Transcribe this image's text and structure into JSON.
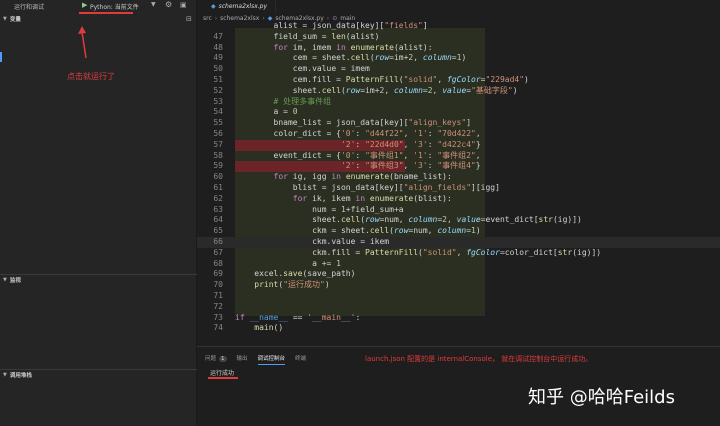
{
  "debug": {
    "toolbar_title": "运行和调试",
    "config_name": "Python: 当前文件",
    "sections": [
      "变量",
      "监视",
      "调用堆栈"
    ]
  },
  "annotation_left": "点击就运行了",
  "tab": {
    "file_name": "schema2xlsx.py"
  },
  "breadcrumb": [
    "src",
    "schema2xlsx",
    "schema2xlsx.py",
    "main"
  ],
  "code_lines": [
    {
      "n": "",
      "html": "        alist = json_data[key][\"fields\"]"
    },
    {
      "n": "47",
      "html": "        field_sum = len(alist)"
    },
    {
      "n": "48",
      "html": "        for im, imem in enumerate(alist):"
    },
    {
      "n": "49",
      "html": "            cem = sheet.cell(row=im+2, column=1)"
    },
    {
      "n": "50",
      "html": "            cem.value = imem"
    },
    {
      "n": "51",
      "html": "            cem.fill = PatternFill(\"solid\", fgColor=\"229ad4\")"
    },
    {
      "n": "52",
      "html": "            sheet.cell(row=im+2, column=2, value=\"基础字段\")"
    },
    {
      "n": "53",
      "html": "        # 处理多事件组"
    },
    {
      "n": "54",
      "html": "        a = 0"
    },
    {
      "n": "55",
      "html": "        bname_list = json_data[key][\"align_keys\"]"
    },
    {
      "n": "56",
      "html": "        color_dict = {'0': \"d44f22\", '1': \"70d422\","
    },
    {
      "n": "57",
      "html": "                      '2': \"22d4d0\", '3': \"d422c4\"}"
    },
    {
      "n": "58",
      "html": "        event_dict = {'0': \"事件组1\", '1': \"事件组2\","
    },
    {
      "n": "59",
      "html": "                      '2': \"事件组3\", '3': \"事件组4\"}"
    },
    {
      "n": "60",
      "html": "        for ig, igg in enumerate(bname_list):"
    },
    {
      "n": "61",
      "html": "            blist = json_data[key][\"align_fields\"][igg]"
    },
    {
      "n": "62",
      "html": "            for ik, ikem in enumerate(blist):"
    },
    {
      "n": "63",
      "html": "                num = 1+field_sum+a"
    },
    {
      "n": "64",
      "html": "                sheet.cell(row=num, column=2, value=event_dict[str(ig)])"
    },
    {
      "n": "65",
      "html": "                ckm = sheet.cell(row=num, column=1)"
    },
    {
      "n": "66",
      "html": "                ckm.value = ikem"
    },
    {
      "n": "67",
      "html": "                ckm.fill = PatternFill(\"solid\", fgColor=color_dict[str(ig)])"
    },
    {
      "n": "68",
      "html": "                a += 1"
    },
    {
      "n": "69",
      "html": "    excel.save(save_path)"
    },
    {
      "n": "70",
      "html": "    print(\"运行成功\")"
    },
    {
      "n": "71",
      "html": ""
    },
    {
      "n": "72",
      "html": ""
    },
    {
      "n": "73",
      "html": "if __name__ == '__main__':"
    },
    {
      "n": "74",
      "html": "    main()"
    }
  ],
  "panel": {
    "tabs": [
      "问题",
      "输出",
      "调试控制台",
      "终端"
    ],
    "problems_count": "1",
    "message": "launch.json 配置的是 internalConsole， 就在调试控制台中运行成功。",
    "output": "运行成功"
  },
  "watermark": "知乎 @哈哈Feilds",
  "colors": {
    "accent_red": "#e03b3b",
    "bg": "#1e1e1e"
  }
}
